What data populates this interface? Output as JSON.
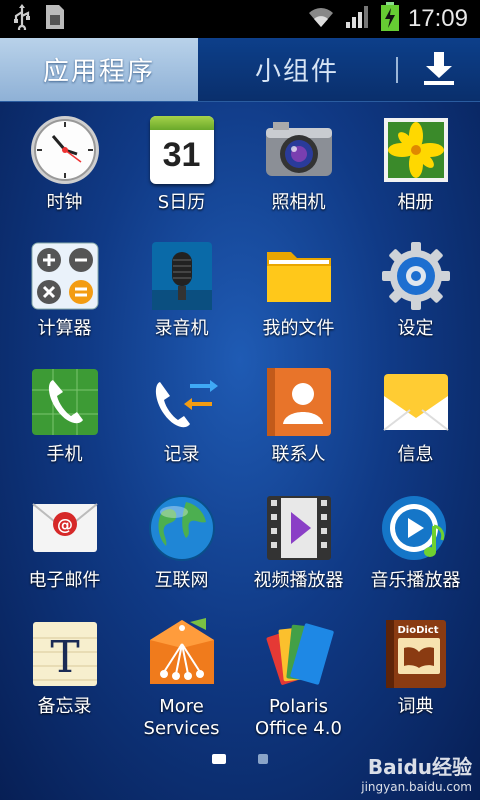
{
  "status_bar": {
    "time": "17:09",
    "icons": [
      "usb-icon",
      "sim-icon",
      "wifi-icon",
      "signal-icon",
      "battery-charging-icon"
    ]
  },
  "tabs": {
    "apps": "应用程序",
    "widgets": "小组件",
    "download_icon": "download-icon"
  },
  "apps": [
    {
      "label": "时钟",
      "icon": "clock-icon"
    },
    {
      "label": "S日历",
      "icon": "calendar-icon",
      "calendar_day": "31"
    },
    {
      "label": "照相机",
      "icon": "camera-icon"
    },
    {
      "label": "相册",
      "icon": "gallery-icon"
    },
    {
      "label": "计算器",
      "icon": "calculator-icon"
    },
    {
      "label": "录音机",
      "icon": "voice-recorder-icon"
    },
    {
      "label": "我的文件",
      "icon": "folder-icon"
    },
    {
      "label": "设定",
      "icon": "settings-gear-icon"
    },
    {
      "label": "手机",
      "icon": "phone-icon"
    },
    {
      "label": "记录",
      "icon": "call-log-icon"
    },
    {
      "label": "联系人",
      "icon": "contacts-icon"
    },
    {
      "label": "信息",
      "icon": "messages-icon"
    },
    {
      "label": "电子邮件",
      "icon": "email-icon"
    },
    {
      "label": "互联网",
      "icon": "globe-icon"
    },
    {
      "label": "视频播放器",
      "icon": "video-player-icon"
    },
    {
      "label": "音乐播放器",
      "icon": "music-player-icon"
    },
    {
      "label": "备忘录",
      "icon": "memo-icon"
    },
    {
      "label": "More\nServices",
      "icon": "more-services-icon"
    },
    {
      "label": "Polaris\nOffice 4.0",
      "icon": "polaris-office-icon"
    },
    {
      "label": "词典",
      "icon": "dictionary-icon",
      "brand": "DioDict"
    }
  ],
  "pager": {
    "pages": 2,
    "current": 1
  },
  "watermark": {
    "title": "Baidu经验",
    "url": "jingyan.baidu.com"
  }
}
